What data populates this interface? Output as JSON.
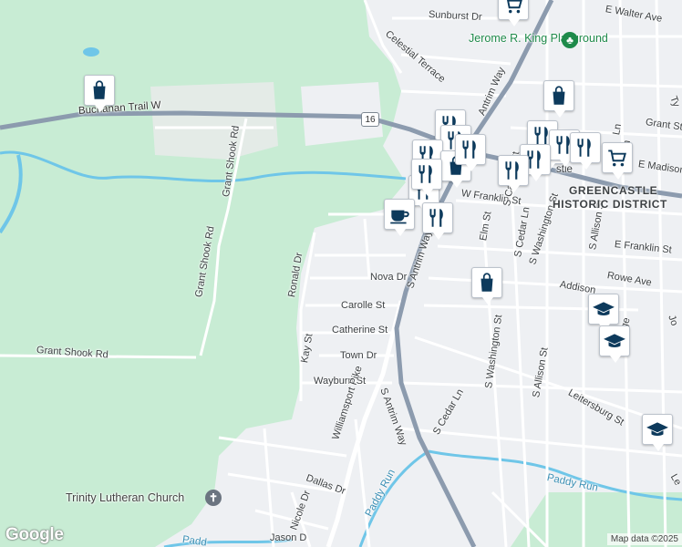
{
  "map": {
    "colors": {
      "land": "#eef0f3",
      "park": "#c8ecd4",
      "water": "#6fc6e8",
      "highway": "#8c9bae",
      "street": "#ffffff",
      "marker": "#0d3a5c"
    },
    "streets": [
      {
        "name": "Buchanan Trail W",
        "cls": "hw"
      },
      {
        "name": "Grant Shook Rd"
      },
      {
        "name": "Grant Shook Rd"
      },
      {
        "name": "Grant Shook Rd"
      },
      {
        "name": "Sunburst Dr"
      },
      {
        "name": "Celestial Terrace"
      },
      {
        "name": "E Walter Ave"
      },
      {
        "name": "Antrim Way"
      },
      {
        "name": "W Franklin St"
      },
      {
        "name": "S Antrim Way"
      },
      {
        "name": "S Antrim Way"
      },
      {
        "name": "Ronald Dr"
      },
      {
        "name": "Nova Dr"
      },
      {
        "name": "Carolle St"
      },
      {
        "name": "Catherine St"
      },
      {
        "name": "Town Dr"
      },
      {
        "name": "Kay St"
      },
      {
        "name": "Wayburn St"
      },
      {
        "name": "Williamsport Pike"
      },
      {
        "name": "Dallas Dr"
      },
      {
        "name": "Nicole Dr"
      },
      {
        "name": "Jason D"
      },
      {
        "name": "S Carlisle St"
      },
      {
        "name": "S Cedar Ln"
      },
      {
        "name": "S Cedar Ln"
      },
      {
        "name": "S Washington St"
      },
      {
        "name": "S Washington St"
      },
      {
        "name": "S Allison St"
      },
      {
        "name": "S Allison St"
      },
      {
        "name": "E Franklin St"
      },
      {
        "name": "Rowe Ave"
      },
      {
        "name": "Addison"
      },
      {
        "name": "Leitersburg St"
      },
      {
        "name": "S Ridge"
      },
      {
        "name": "Grant St"
      },
      {
        "name": "E Madison"
      },
      {
        "name": "Elm St"
      },
      {
        "name": "Le"
      },
      {
        "name": "Jo"
      },
      {
        "name": "Ty"
      },
      {
        "name": "Ln"
      },
      {
        "name": "Ln"
      }
    ],
    "places": {
      "park": "Jerome R. King Playground",
      "church": "Trinity Lutheran Church",
      "district_line1": "GREENCASTLE",
      "district_line2": "HISTORIC DISTRICT",
      "creek1": "Paddy Run",
      "creek2": "Paddy Run",
      "creek3": "Padd",
      "town_fragment": "stle"
    },
    "route_shield": "16",
    "markers": [
      {
        "type": "shopping",
        "icon": "shopping-bag-icon"
      },
      {
        "type": "shopping",
        "icon": "shopping-cart-icon"
      },
      {
        "type": "restaurant",
        "icon": "fork-knife-icon"
      },
      {
        "type": "restaurant",
        "icon": "fork-knife-icon"
      },
      {
        "type": "restaurant",
        "icon": "fork-knife-icon"
      },
      {
        "type": "shopping",
        "icon": "shopping-bag-icon"
      },
      {
        "type": "restaurant",
        "icon": "fork-knife-icon"
      },
      {
        "type": "restaurant",
        "icon": "fork-knife-icon"
      },
      {
        "type": "shopping",
        "icon": "shopping-bag-icon"
      },
      {
        "type": "shopping",
        "icon": "shopping-bag-icon"
      },
      {
        "type": "restaurant",
        "icon": "fork-knife-icon"
      },
      {
        "type": "restaurant",
        "icon": "fork-knife-icon"
      },
      {
        "type": "restaurant",
        "icon": "fork-knife-icon"
      },
      {
        "type": "restaurant",
        "icon": "fork-knife-icon"
      },
      {
        "type": "restaurant",
        "icon": "fork-knife-icon"
      },
      {
        "type": "shopping",
        "icon": "shopping-cart-icon"
      },
      {
        "type": "restaurant",
        "icon": "fork-knife-icon"
      },
      {
        "type": "cafe",
        "icon": "coffee-cup-icon"
      },
      {
        "type": "restaurant",
        "icon": "fork-knife-icon"
      },
      {
        "type": "shopping",
        "icon": "shopping-bag-icon"
      },
      {
        "type": "school",
        "icon": "graduation-cap-icon"
      },
      {
        "type": "school",
        "icon": "graduation-cap-icon"
      },
      {
        "type": "school",
        "icon": "graduation-cap-icon"
      }
    ],
    "branding": "Google",
    "attribution": "Map data ©2025"
  }
}
